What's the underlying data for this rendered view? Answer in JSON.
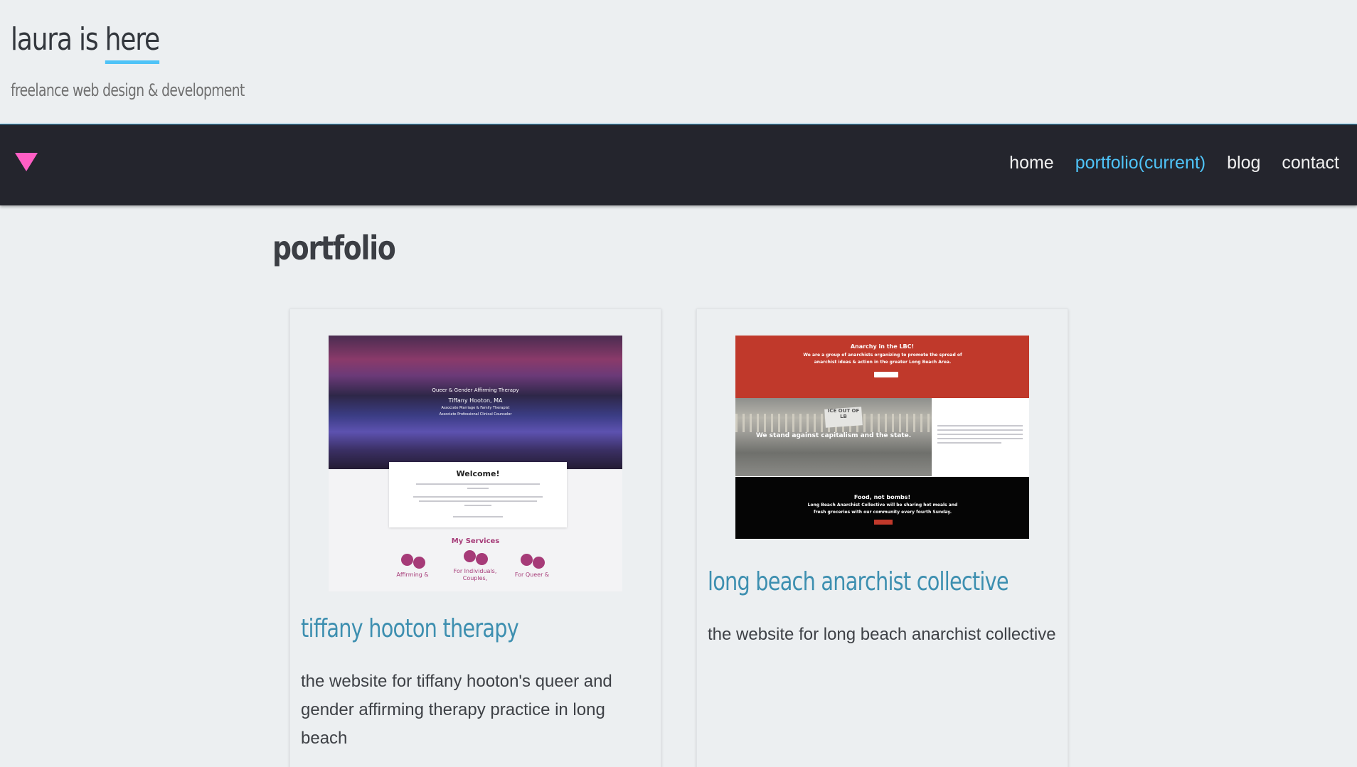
{
  "site": {
    "title_part1": "laura is ",
    "title_part2": "here",
    "description": "freelance web design & development",
    "accent_color": "#4fc3f7",
    "toggle_color": "#ff5ec4"
  },
  "nav": {
    "toggle_icon": "triangle-down-icon",
    "items": [
      {
        "label": "home"
      },
      {
        "label": "portfolio(current)"
      },
      {
        "label": "blog"
      },
      {
        "label": "contact"
      }
    ]
  },
  "page": {
    "title": "portfolio"
  },
  "portfolio": [
    {
      "title": "tiffany hooton therapy",
      "description": "the website for tiffany hooton's queer and gender affirming therapy practice in long beach",
      "thumbnail": {
        "hero_lines": [
          "Queer & Gender Affirming Therapy",
          "Tiffany Hooton, MA",
          "Associate Marriage & Family Therapist",
          "Associate Professional Clinical Counselor"
        ],
        "welcome": "Welcome!",
        "services_heading": "My Services",
        "services": [
          "Affirming &",
          "For Individuals, Couples,",
          "For Queer &"
        ]
      }
    },
    {
      "title": "long beach anarchist collective",
      "description": "the website for long beach anarchist collective",
      "thumbnail": {
        "banner_title": "Anarchy in the LBC!",
        "banner_text": "We are a group of anarchists organizing to promote the spread of anarchist ideas & action in the greater Long Beach Area.",
        "sign_text": "ICE OUT OF LB",
        "photo_caption": "We stand against capitalism and the state.",
        "food_title": "Food, not bombs!",
        "food_text": "Long Beach Anarchist Collective will be sharing hot meals and fresh groceries with our community every fourth Sunday."
      }
    }
  ]
}
